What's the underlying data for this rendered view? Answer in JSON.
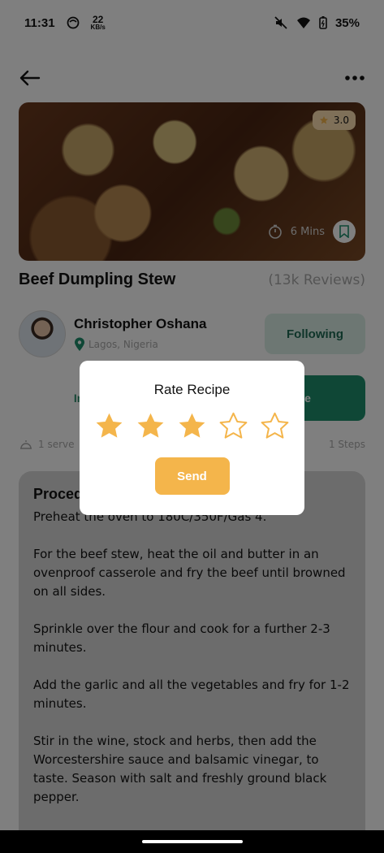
{
  "status_bar": {
    "time": "11:31",
    "net_speed": "22",
    "net_unit": "KB/s",
    "battery": "35%"
  },
  "header": {
    "back_icon": "arrow-left-icon",
    "menu_icon": "more-horizontal-icon"
  },
  "recipe": {
    "rating": "3.0",
    "time": "6 Mins",
    "title": "Beef Dumpling Stew",
    "reviews": "(13k Reviews)"
  },
  "author": {
    "name": "Christopher Oshana",
    "location": "Lagos, Nigeria",
    "follow_label": "Following"
  },
  "tabs": {
    "ingredient": "Ingredient",
    "procedure": "Procedure"
  },
  "meta": {
    "serve": "1 serve",
    "steps": "1 Steps"
  },
  "procedure": {
    "title": "Procedure",
    "steps": [
      "Preheat the oven to 180C/350F/Gas 4.",
      "For the beef stew, heat the oil and butter in an ovenproof casserole and fry the beef until browned on all sides.",
      "Sprinkle over the flour and cook for a further 2-3 minutes.",
      "Add the garlic and all the vegetables and fry for 1-2 minutes.",
      "Stir in the wine, stock and herbs, then add the Worcestershire sauce and balsamic vinegar, to taste. Season with salt and freshly ground black pepper."
    ]
  },
  "dialog": {
    "title": "Rate Recipe",
    "rating": 3,
    "max_rating": 5,
    "send_label": "Send"
  },
  "colors": {
    "primary": "#1f8f6d",
    "star": "#f4b54b",
    "send": "#f4b54b"
  }
}
